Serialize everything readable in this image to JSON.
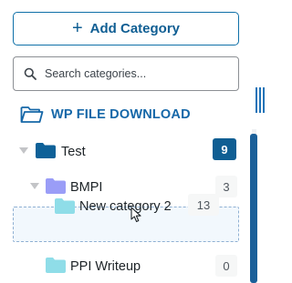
{
  "toolbar": {
    "add_label": "Add Category",
    "add_icon": "plus-icon"
  },
  "search": {
    "placeholder": "Search categories...",
    "value": ""
  },
  "root": {
    "label": "WP FILE DOWNLOAD"
  },
  "tree": {
    "test": {
      "label": "Test",
      "count": "9"
    },
    "bmpi": {
      "label": "BMPI",
      "count": "3"
    },
    "dragging": {
      "label": "New category 2",
      "count": "13"
    },
    "ppi": {
      "label": "PPI Writeup",
      "count": "0"
    }
  },
  "colors": {
    "accent": "#0f5e93",
    "test_folder": "#0e6198",
    "bmpi_folder": "#9a9df7",
    "child_folder": "#8fdde8"
  }
}
